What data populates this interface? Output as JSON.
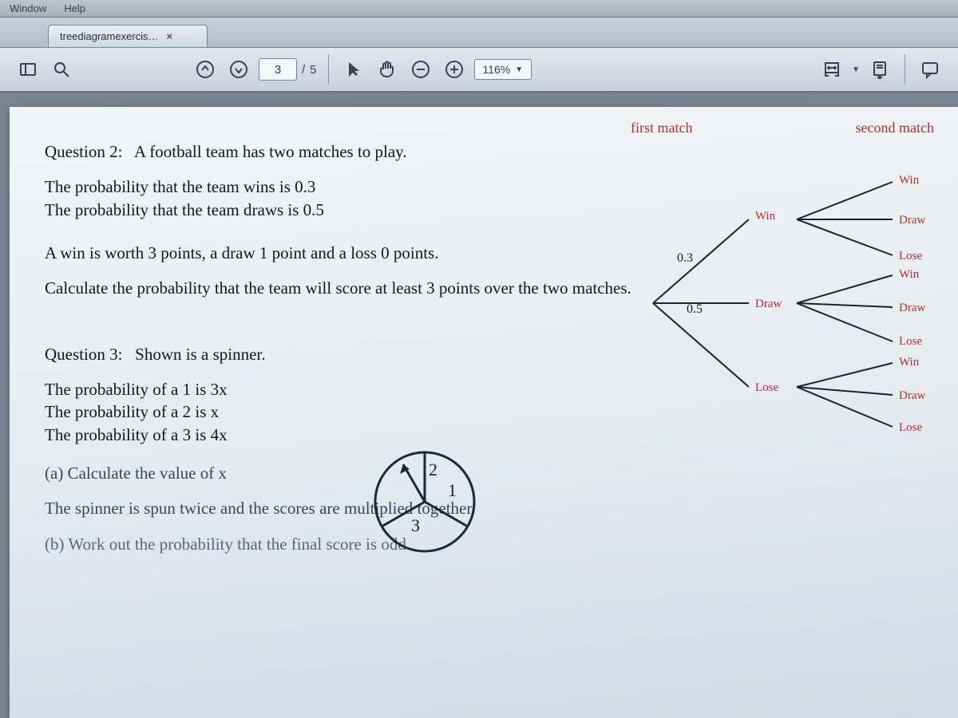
{
  "menubar": {
    "window": "Window",
    "help": "Help"
  },
  "tab": {
    "title": "treediagramexercis…",
    "close": "×"
  },
  "toolbar": {
    "current_page": "3",
    "page_sep": "/",
    "total_pages": "5",
    "zoom": "116%"
  },
  "tree": {
    "heading1": "first match",
    "heading2": "second match",
    "first": {
      "win": "Win",
      "draw": "Draw",
      "lose": "Lose"
    },
    "second": {
      "a": {
        "win": "Win",
        "draw": "Draw",
        "lose": "Lose"
      },
      "b": {
        "win": "Win",
        "draw": "Draw",
        "lose": "Lose"
      },
      "c": {
        "win": "Win",
        "draw": "Draw",
        "lose": "Lose"
      }
    },
    "probs": {
      "p_win": "0.3",
      "p_draw": "0.5"
    }
  },
  "q2": {
    "label": "Question 2:",
    "title": "A football team has two matches to play.",
    "line1": "The probability that the team wins is 0.3",
    "line2": "The probability that the team draws is 0.5",
    "line3": "A win is worth 3 points, a draw 1 point and a loss 0 points.",
    "line4": "Calculate the probability that the team will score at least 3 points over the two matches."
  },
  "q3": {
    "label": "Question 3:",
    "title": "Shown is a spinner.",
    "line1": "The probability of a 1 is 3x",
    "line2": "The probability of a 2 is x",
    "line3": "The probability of a 3 is 4x",
    "sub_a": "(a)   Calculate the value of x",
    "line4": "The spinner is spun twice and the scores are multiplied together.",
    "sub_b": "(b)  Work out the probability that the final score is odd."
  },
  "spinner": {
    "s1": "1",
    "s2": "2",
    "s3": "3"
  }
}
